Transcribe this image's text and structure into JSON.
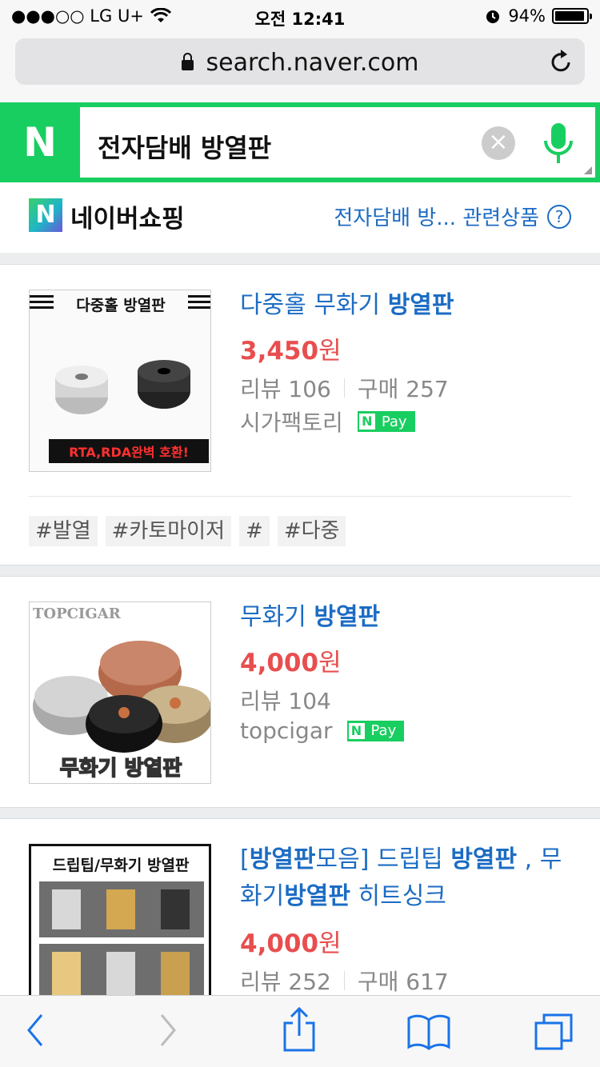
{
  "status_bar": {
    "carrier": "●●●○○ LG U+",
    "time": "오전 12:41",
    "battery": "94%",
    "battery_level": 0.94
  },
  "browser": {
    "url": "search.naver.com"
  },
  "search": {
    "logo": "N",
    "query": "전자담배 방열판",
    "accent_color": "#19ce60"
  },
  "shopping": {
    "logo": "N",
    "title": "네이버쇼핑",
    "related_link": "전자담배 방... 관련상품",
    "help": "?"
  },
  "products": [
    {
      "title_parts": [
        "다중홀 무화기 ",
        "방열판"
      ],
      "price_number": "3,450",
      "price_unit": "원",
      "reviews": "리뷰 106",
      "purchases": "구매 257",
      "seller": "시가팩토리",
      "npay": "Pay",
      "thumb_caption_top": "다중홀 방열판",
      "thumb_caption_bottom": "RTA,RDA완벽 호환!",
      "tags": [
        "#발열",
        "#카토마이저",
        "#",
        "#다중"
      ]
    },
    {
      "title_parts": [
        "무화기 ",
        "방열판"
      ],
      "price_number": "4,000",
      "price_unit": "원",
      "reviews": "리뷰 104",
      "seller": "topcigar",
      "npay": "Pay",
      "thumb_caption_top": "TOPCIGAR",
      "thumb_caption_bottom": "무화기 방열판"
    },
    {
      "title_parts": [
        "[",
        "방열판",
        "모음] 드립팁 ",
        "방열판",
        " , 무화기",
        "방열판",
        " 히트싱크"
      ],
      "price_number": "4,000",
      "price_unit": "원",
      "reviews": "리뷰 252",
      "purchases": "구매 617",
      "thumb_caption_top": "드립팁/무화기 방열판"
    }
  ],
  "toolbar": {
    "icons": [
      "back-icon",
      "forward-icon",
      "share-icon",
      "bookmarks-icon",
      "tabs-icon"
    ]
  }
}
